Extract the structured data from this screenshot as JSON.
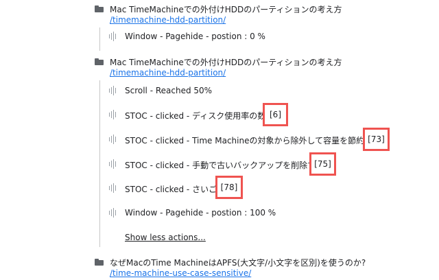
{
  "sessions": [
    {
      "page_title": "Mac TimeMachineでの外付けHDDのパーティションの考え方",
      "page_path": "/timemachine-hdd-partition/",
      "actions": [
        {
          "label": "Window - Pagehide - postion : 0 %"
        }
      ]
    },
    {
      "page_title": "Mac TimeMachineでの外付けHDDのパーティションの考え方",
      "page_path": "/timemachine-hdd-partition/",
      "actions": [
        {
          "label": "Scroll - Reached 50%"
        },
        {
          "label": "STOC - clicked - ディスク使用率の数値",
          "badge": "[6]"
        },
        {
          "label": "STOC - clicked - Time Machineの対象から除外して容量を節約する",
          "badge": "[73]"
        },
        {
          "label": "STOC - clicked - 手動で古いバックアップを削除する",
          "badge": "[75]"
        },
        {
          "label": "STOC - clicked - さいごに",
          "badge": "[78]"
        },
        {
          "label": "Window - Pagehide - postion : 100 %"
        }
      ],
      "show_less_label": "Show less actions..."
    },
    {
      "page_title": "なぜMacのTime MachineはAPFS(大文字/小文字を区別)を使うのか?",
      "page_path": "/time-machine-use-case-sensitive/"
    }
  ],
  "icons": {
    "page": "folder-icon",
    "action": "audio-waveform-icon"
  },
  "colors": {
    "link": "#1a73e8",
    "highlight": "#ef5350",
    "text": "#202124",
    "icon": "#5f6368"
  }
}
